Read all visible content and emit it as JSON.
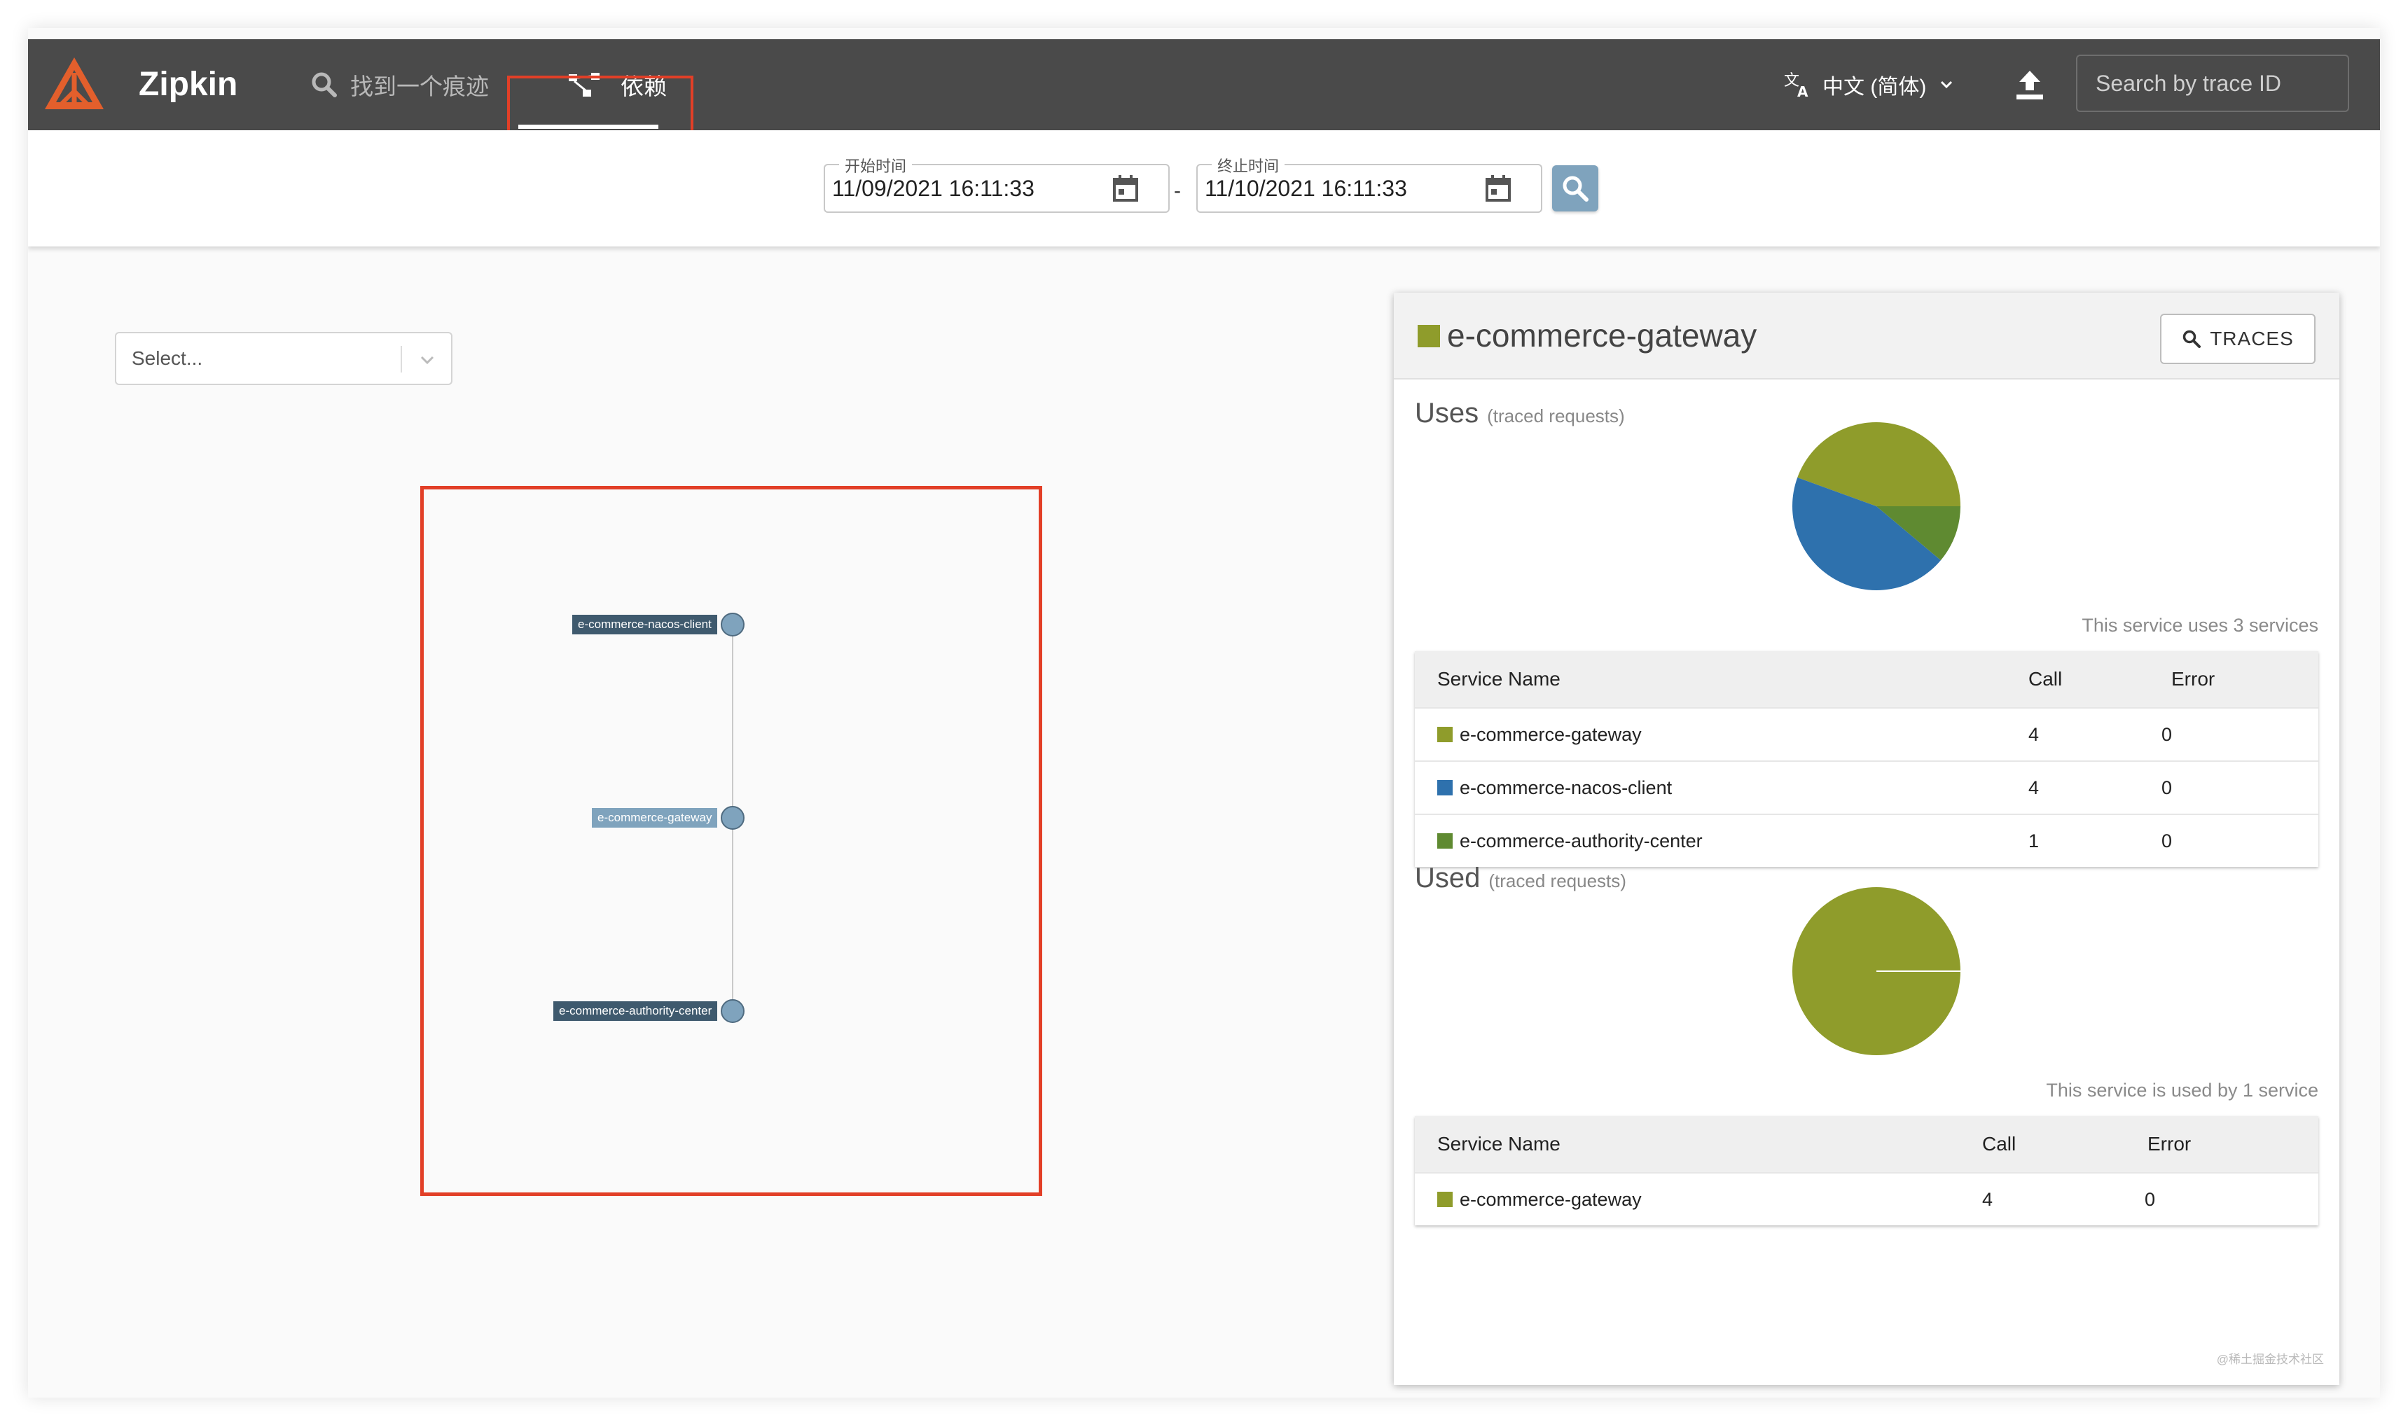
{
  "app": {
    "brand": "Zipkin",
    "nav": {
      "find_label": "找到一个痕迹",
      "dependencies_label": "依赖"
    },
    "language": "中文 (简体)",
    "search_placeholder": "Search by trace ID",
    "icons": [
      "zipkin-logo-icon",
      "search-icon",
      "dependency-graph-icon",
      "translate-icon",
      "chevron-down-icon",
      "upload-icon",
      "calendar-icon"
    ]
  },
  "filter": {
    "start_label": "开始时间",
    "start_value": "11/09/2021 16:11:33",
    "separator": "-",
    "end_label": "终止时间",
    "end_value": "11/10/2021 16:11:33"
  },
  "graph": {
    "select_placeholder": "Select...",
    "nodes": [
      {
        "name": "e-commerce-nacos-client"
      },
      {
        "name": "e-commerce-gateway"
      },
      {
        "name": "e-commerce-authority-center"
      }
    ],
    "edges": [
      {
        "from": "e-commerce-gateway",
        "to": "e-commerce-nacos-client"
      },
      {
        "from": "e-commerce-gateway",
        "to": "e-commerce-authority-center"
      }
    ]
  },
  "detail": {
    "title": "e-commerce-gateway",
    "title_color": "#8f9c2b",
    "traces_label": "TRACES",
    "uses": {
      "title": "Uses",
      "subtitle": "(traced requests)",
      "caption": "This service uses 3 services",
      "headers": {
        "name": "Service Name",
        "call": "Call",
        "error": "Error"
      },
      "rows": [
        {
          "name": "e-commerce-gateway",
          "call": "4",
          "error": "0",
          "color": "#8f9c2b"
        },
        {
          "name": "e-commerce-nacos-client",
          "call": "4",
          "error": "0",
          "color": "#2e71ad"
        },
        {
          "name": "e-commerce-authority-center",
          "call": "1",
          "error": "0",
          "color": "#5f8a31"
        }
      ]
    },
    "used": {
      "title": "Used",
      "subtitle": "(traced requests)",
      "caption": "This service is used by 1 service",
      "headers": {
        "name": "Service Name",
        "call": "Call",
        "error": "Error"
      },
      "rows": [
        {
          "name": "e-commerce-gateway",
          "call": "4",
          "error": "0",
          "color": "#8f9c2b"
        }
      ]
    }
  },
  "watermark": "@稀土掘金技术社区"
}
